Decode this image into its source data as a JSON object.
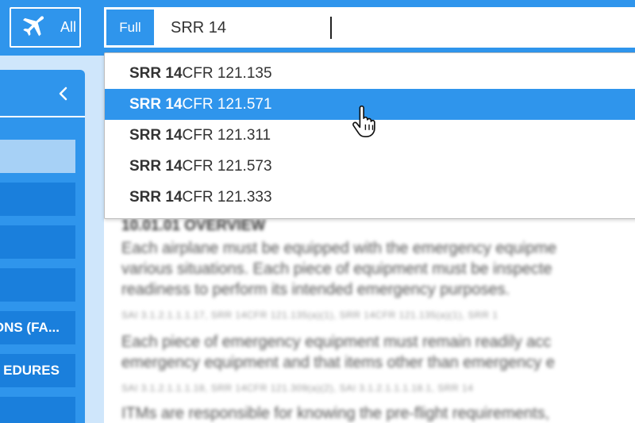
{
  "topbar": {
    "filter_label": "All",
    "filter_icon": "airplane-icon",
    "mode_label": "Full",
    "search_value": "SRR 14"
  },
  "sidebar": {
    "collapse_icon": "chevron-left-icon",
    "items": [
      {
        "label": "",
        "active": true
      },
      {
        "label": ""
      },
      {
        "label": ""
      },
      {
        "label": ""
      },
      {
        "label": "ONS (FA..."
      },
      {
        "label": "EDURES"
      },
      {
        "label": ""
      }
    ]
  },
  "dropdown": {
    "items": [
      {
        "match": "SRR 14",
        "rest": "CFR 121.135"
      },
      {
        "match": "SRR 14",
        "rest": "CFR 121.571",
        "hover": true
      },
      {
        "match": "SRR 14",
        "rest": "CFR 121.311"
      },
      {
        "match": "SRR 14",
        "rest": "CFR 121.573"
      },
      {
        "match": "SRR 14",
        "rest": "CFR 121.333"
      }
    ]
  },
  "document": {
    "section_title": "10.01.01   OVERVIEW",
    "para1": [
      "Each airplane must be equipped with the emergency equipme",
      "various situations. Each piece of equipment must be inspecte",
      "readiness to perform its intended emergency purposes."
    ],
    "refs1": "SAI 3.1.2.1.1.1.17,     SRR 14CFR 121.135(a)(1),     SRR 14CFR 121.135(a)(1),     SRR 1",
    "para2": [
      "Each piece of emergency equipment must remain readily acc",
      "emergency equipment and that items other than emergency e"
    ],
    "refs2": "SAI 3.1.2.1.1.1.18,     SRR 14CFR 121.309(a)(2),     SAI 3.1.2.1.1.1.18.1,     SRR 14",
    "para3": [
      "ITMs are responsible for knowing the pre-flight requirements,"
    ]
  }
}
